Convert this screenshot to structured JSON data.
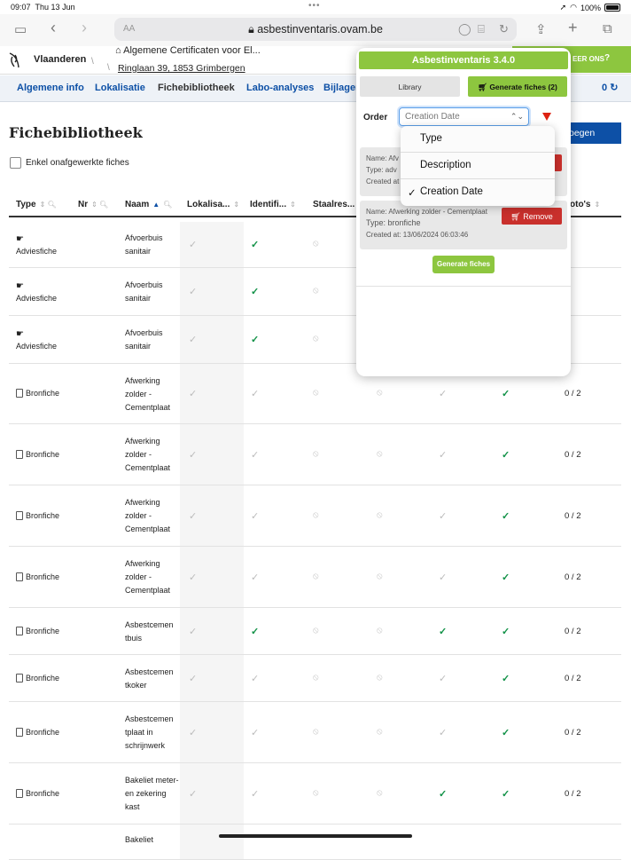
{
  "status": {
    "time": "09:07",
    "date": "Thu 13 Jun",
    "battery": "100%"
  },
  "browser": {
    "aa": "AA",
    "url": "asbestinventaris.ovam.be"
  },
  "header": {
    "brand": "Vlaanderen",
    "breadcrumb_title": "Algemene Certificaten voor El...",
    "breadcrumb_address": "Ringlaan 39, 1853 Grimbergen",
    "contact": "EER ONS"
  },
  "nav": {
    "items": [
      "Algemene info",
      "Lokalisatie",
      "Fichebibliotheek",
      "Labo-analyses",
      "Bijlagen"
    ],
    "count": "0"
  },
  "page": {
    "title": "Fichebibliotheek",
    "checkbox_label": "Enkel onafgewerkte fiches",
    "add_button": "oegen"
  },
  "table": {
    "headers": [
      "Type",
      "Nr",
      "Naam",
      "Lokalisa...",
      "Identifi...",
      "Staalres...",
      "oto's"
    ],
    "rows": [
      {
        "type": "Adviesfiche",
        "name": "Afvoerbuis sanitair",
        "photos": ""
      },
      {
        "type": "Adviesfiche",
        "name": "Afvoerbuis sanitair",
        "photos": ""
      },
      {
        "type": "Adviesfiche",
        "name": "Afvoerbuis sanitair",
        "photos": ""
      },
      {
        "type": "Bronfiche",
        "name": "Afwerking zolder - Cementplaat",
        "photos": "0 / 2"
      },
      {
        "type": "Bronfiche",
        "name": "Afwerking zolder - Cementplaat",
        "photos": "0 / 2"
      },
      {
        "type": "Bronfiche",
        "name": "Afwerking zolder - Cementplaat",
        "photos": "0 / 2"
      },
      {
        "type": "Bronfiche",
        "name": "Afwerking zolder - Cementplaat",
        "photos": "0 / 2"
      },
      {
        "type": "Bronfiche",
        "name": "Asbestcemen tbuis",
        "photos": "0 / 2"
      },
      {
        "type": "Bronfiche",
        "name": "Asbestcemen tkoker",
        "photos": "0 / 2"
      },
      {
        "type": "Bronfiche",
        "name": "Asbestcemen tplaat in schrijnwerk",
        "photos": "0 / 2"
      },
      {
        "type": "Bronfiche",
        "name": "Bakeliet meter- en zekering kast",
        "photos": "0 / 2"
      },
      {
        "type": "",
        "name": "Bakeliet",
        "photos": ""
      }
    ]
  },
  "popup": {
    "title": "Asbestinventaris 3.4.0",
    "library": "Library",
    "generate": "Generate fiches (2)",
    "order_label": "Order",
    "order_value": "Creation Date",
    "cards": [
      {
        "name": "Name: Afv",
        "type": "Type: adv",
        "created": "Created at",
        "remove": ""
      },
      {
        "name": "Name: Afwerking zolder - Cementplaat",
        "type": "Type: bronfiche",
        "created": "Created at: 13/06/2024 06:03:46",
        "remove": "Remove"
      }
    ],
    "generate_bottom": "Generate fiches"
  },
  "dropdown": {
    "options": [
      "Type",
      "Description",
      "Creation Date"
    ],
    "checked": "✓"
  },
  "colors": {
    "accent_green": "#8dc63f",
    "link_blue": "#0d50a6",
    "remove_red": "#c9302c"
  }
}
